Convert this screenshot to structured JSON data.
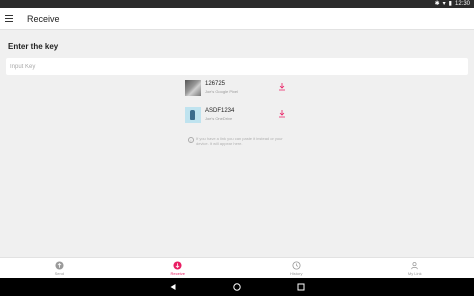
{
  "status_bar": {
    "time": "12:30",
    "icons": [
      "bluetooth-icon",
      "wifi-icon",
      "battery-icon"
    ]
  },
  "app_bar": {
    "title": "Receive",
    "menu_icon": "hamburger-menu-icon"
  },
  "main": {
    "heading": "Enter the key",
    "input": {
      "placeholder": "Input Key",
      "value": ""
    },
    "received": [
      {
        "code": "126725",
        "subtitle": "Joe's Google Pixel",
        "thumb_icon": "photo-thumbnail-icon",
        "action_icon": "download-icon"
      },
      {
        "code": "ASDF1234",
        "subtitle": "Joe's OneDrive",
        "thumb_icon": "file-thumbnail-icon",
        "action_icon": "download-icon"
      }
    ],
    "info_text": "If you have a link you can paste it instead or your device. It will appear here."
  },
  "bottom_nav": [
    {
      "label": "Send",
      "icon": "upload-icon",
      "active": false
    },
    {
      "label": "Receive",
      "icon": "download-icon",
      "active": true
    },
    {
      "label": "History",
      "icon": "clock-icon",
      "active": false
    },
    {
      "label": "My Link",
      "icon": "link-icon",
      "active": false
    }
  ],
  "colors": {
    "accent": "#e91e63",
    "status_bar": "#2b2b2b",
    "background": "#f0f0f0"
  }
}
